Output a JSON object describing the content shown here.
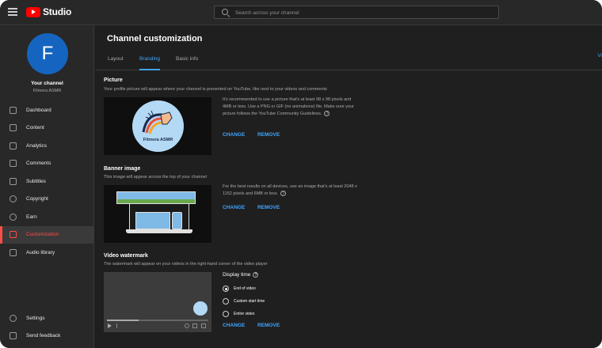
{
  "topbar": {
    "logo_text": "Studio",
    "search_placeholder": "Search across your channel"
  },
  "sidebar": {
    "avatar_letter": "F",
    "channel_label": "Your channel",
    "channel_name": "Filmora ASMR",
    "items": [
      {
        "label": "Dashboard",
        "icon": "dashboard-icon"
      },
      {
        "label": "Content",
        "icon": "content-icon"
      },
      {
        "label": "Analytics",
        "icon": "analytics-icon"
      },
      {
        "label": "Comments",
        "icon": "comments-icon"
      },
      {
        "label": "Subtitles",
        "icon": "subtitles-icon"
      },
      {
        "label": "Copyright",
        "icon": "copyright-icon"
      },
      {
        "label": "Earn",
        "icon": "earn-icon"
      },
      {
        "label": "Customization",
        "icon": "customization-icon",
        "active": true
      },
      {
        "label": "Audio library",
        "icon": "audio-library-icon"
      }
    ],
    "bottom_items": [
      {
        "label": "Settings",
        "icon": "gear-icon"
      },
      {
        "label": "Send feedback",
        "icon": "feedback-icon"
      }
    ]
  },
  "main": {
    "title": "Channel customization",
    "tabs": [
      {
        "label": "Layout"
      },
      {
        "label": "Branding",
        "active": true
      },
      {
        "label": "Basic info"
      }
    ],
    "right_link": "Vi",
    "picture": {
      "title": "Picture",
      "description": "Your profile picture will appear where your channel is presented on YouTube, like next to your videos and comments",
      "image_label": "Filmora ASMR",
      "info": "It's recommended to use a picture that's at least 98 x 98 pixels and 4MB or less. Use a PNG or GIF (no animations) file. Make sure your picture follows the YouTube Community Guidelines.",
      "change_label": "CHANGE",
      "remove_label": "REMOVE"
    },
    "banner": {
      "title": "Banner image",
      "description": "This image will appear across the top of your channel",
      "info": "For the best results on all devices, use an image that's at least 2048 x 1152 pixels and 6MB or less.",
      "change_label": "CHANGE",
      "remove_label": "REMOVE"
    },
    "watermark": {
      "title": "Video watermark",
      "description": "The watermark will appear on your videos in the right-hand corner of the video player",
      "display_time_label": "Display time",
      "options": [
        {
          "label": "End of video",
          "checked": true
        },
        {
          "label": "Custom start time",
          "checked": false
        },
        {
          "label": "Entire video",
          "checked": false
        }
      ],
      "change_label": "CHANGE",
      "remove_label": "REMOVE"
    }
  },
  "colors": {
    "accent": "#3ea6ff",
    "active_nav": "#ff4e45",
    "brand_red": "#ff0000",
    "avatar": "#1565c0"
  }
}
